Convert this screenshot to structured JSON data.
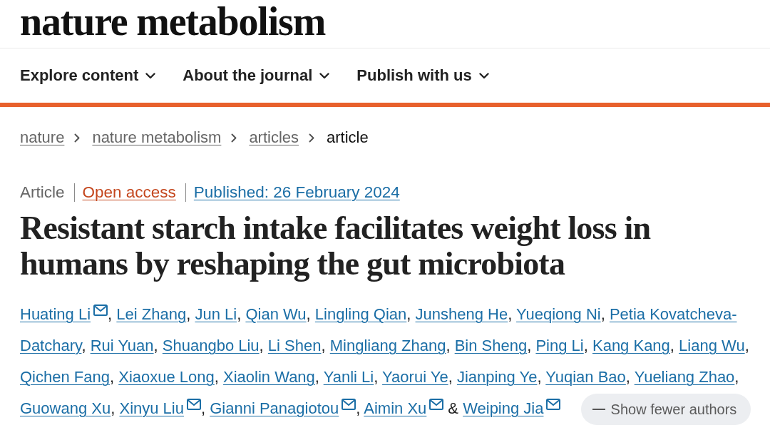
{
  "journal": {
    "name": "nature metabolism"
  },
  "nav": [
    {
      "label": "Explore content"
    },
    {
      "label": "About the journal"
    },
    {
      "label": "Publish with us"
    }
  ],
  "breadcrumb": [
    {
      "label": "nature",
      "current": false
    },
    {
      "label": "nature metabolism",
      "current": false
    },
    {
      "label": "articles",
      "current": false
    },
    {
      "label": "article",
      "current": true
    }
  ],
  "article_meta": {
    "type": "Article",
    "access": "Open access",
    "published": "Published: 26 February 2024"
  },
  "title": "Resistant starch intake facilitates weight loss in humans by reshaping the gut microbiota",
  "authors": [
    {
      "name": "Huating Li",
      "email": true,
      "separator": ","
    },
    {
      "name": "Lei Zhang",
      "email": false,
      "separator": ","
    },
    {
      "name": "Jun Li",
      "email": false,
      "separator": ","
    },
    {
      "name": "Qian Wu",
      "email": false,
      "separator": ","
    },
    {
      "name": "Lingling Qian",
      "email": false,
      "separator": ","
    },
    {
      "name": "Junsheng He",
      "email": false,
      "separator": ","
    },
    {
      "name": "Yueqiong Ni",
      "email": false,
      "separator": ","
    },
    {
      "name": "Petia Kovatcheva-Datchary",
      "email": false,
      "separator": ","
    },
    {
      "name": "Rui Yuan",
      "email": false,
      "separator": ","
    },
    {
      "name": "Shuangbo Liu",
      "email": false,
      "separator": ","
    },
    {
      "name": "Li Shen",
      "email": false,
      "separator": ","
    },
    {
      "name": "Mingliang Zhang",
      "email": false,
      "separator": ","
    },
    {
      "name": "Bin Sheng",
      "email": false,
      "separator": ","
    },
    {
      "name": "Ping Li",
      "email": false,
      "separator": ","
    },
    {
      "name": "Kang Kang",
      "email": false,
      "separator": ","
    },
    {
      "name": "Liang Wu",
      "email": false,
      "separator": ","
    },
    {
      "name": "Qichen Fang",
      "email": false,
      "separator": ","
    },
    {
      "name": "Xiaoxue Long",
      "email": false,
      "separator": ","
    },
    {
      "name": "Xiaolin Wang",
      "email": false,
      "separator": ","
    },
    {
      "name": "Yanli Li",
      "email": false,
      "separator": ","
    },
    {
      "name": "Yaorui Ye",
      "email": false,
      "separator": ","
    },
    {
      "name": "Jianping Ye",
      "email": false,
      "separator": ","
    },
    {
      "name": "Yuqian Bao",
      "email": false,
      "separator": ","
    },
    {
      "name": "Yueliang Zhao",
      "email": false,
      "separator": ","
    },
    {
      "name": "Guowang Xu",
      "email": false,
      "separator": ","
    },
    {
      "name": "Xinyu Liu",
      "email": true,
      "separator": ","
    },
    {
      "name": "Gianni Panagiotou",
      "email": true,
      "separator": ","
    },
    {
      "name": "Aimin Xu",
      "email": true,
      "separator": "&"
    },
    {
      "name": "Weiping Jia",
      "email": true
    }
  ],
  "authors_toggle": {
    "label": "Show fewer authors",
    "expanded": true
  }
}
